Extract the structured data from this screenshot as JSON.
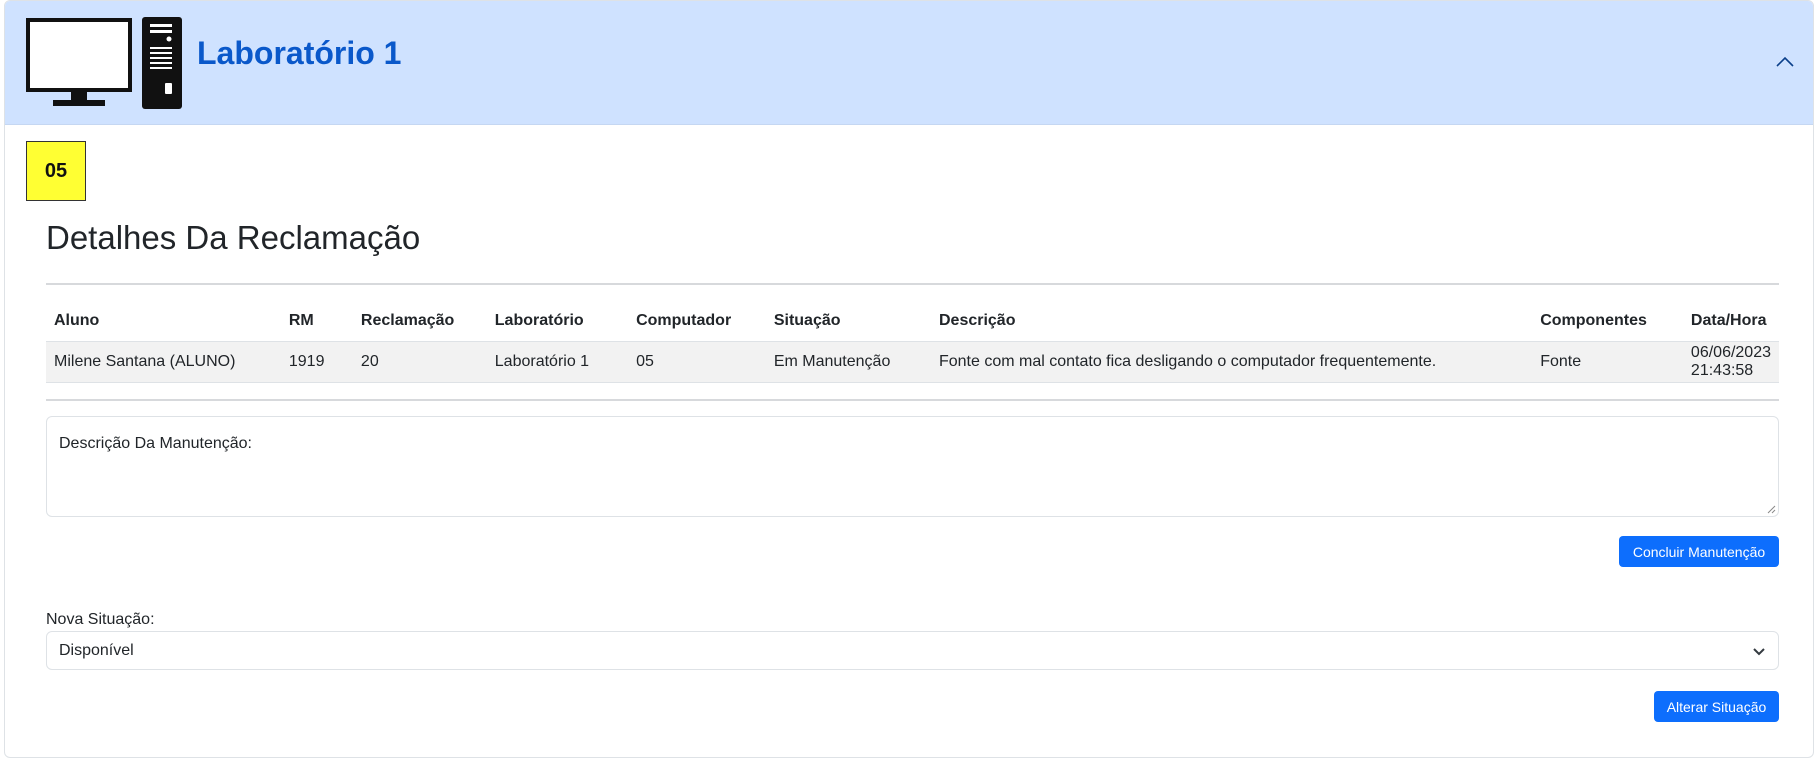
{
  "header": {
    "title": "Laboratório 1",
    "icon": "desktop-computer-icon",
    "collapse_icon": "chevron-up-icon",
    "background": "#cfe2ff",
    "title_color": "#0a58ca"
  },
  "computer": {
    "number": "05",
    "badge_color": "#ffff33"
  },
  "details": {
    "title": "Detalhes Da Reclamação",
    "columns": [
      "Aluno",
      "RM",
      "Reclamação",
      "Laboratório",
      "Computador",
      "Situação",
      "Descrição",
      "Componentes",
      "Data/Hora"
    ],
    "rows": [
      [
        "Milene Santana (ALUNO)",
        "1919",
        "20",
        "Laboratório 1",
        "05",
        "Em Manutenção",
        "Fonte com mal contato fica desligando o computador frequentemente.",
        "Fonte",
        "06/06/2023 21:43:58"
      ]
    ]
  },
  "maintenance": {
    "placeholder": "Descrição Da Manutenção:",
    "value": "",
    "submit_label": "Concluir Manutenção"
  },
  "status": {
    "label": "Nova Situação:",
    "selected": "Disponível",
    "submit_label": "Alterar Situação"
  },
  "colors": {
    "primary": "#0d6efd"
  }
}
